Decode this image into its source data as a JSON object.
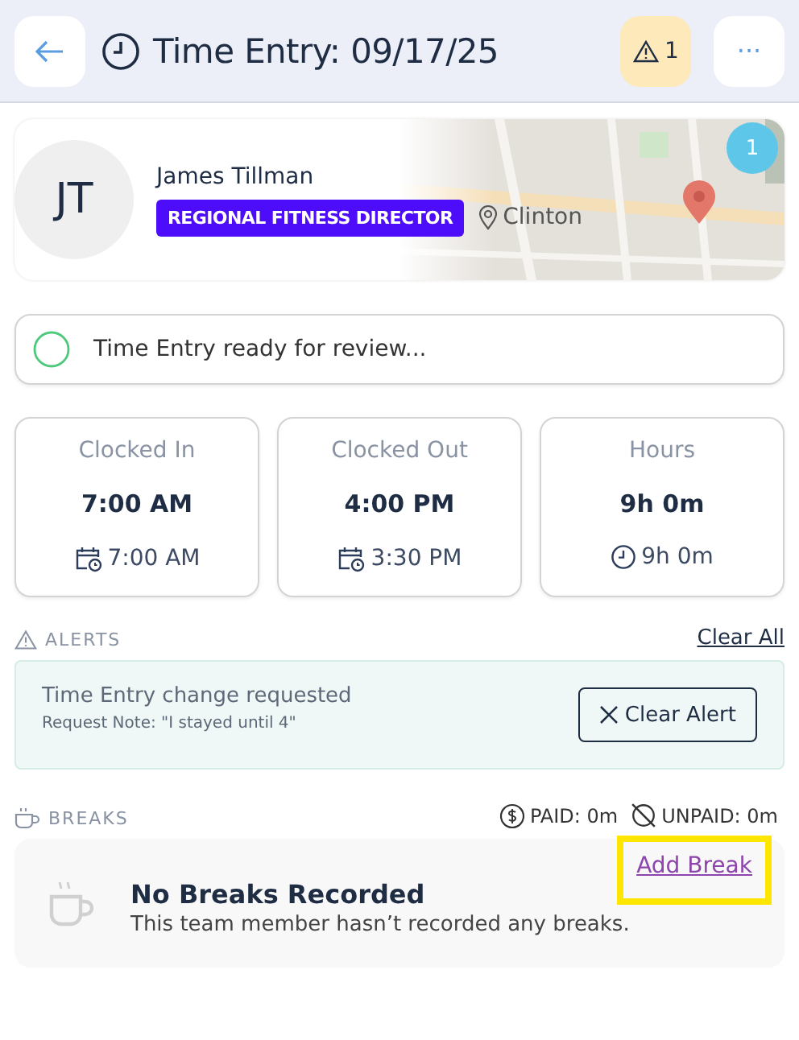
{
  "header": {
    "title": "Time Entry: 09/17/25",
    "alert_count": "1",
    "more": "···"
  },
  "profile": {
    "initials": "JT",
    "name": "James Tillman",
    "role": "REGIONAL FITNESS DIRECTOR",
    "location": "Clinton",
    "map": {
      "kind": "picture",
      "badge": "1"
    }
  },
  "status": {
    "text": "Time Entry ready for review..."
  },
  "stats": [
    {
      "label": "Clocked In",
      "value": "7:00 AM",
      "detail": "7:00 AM",
      "kind": "calendar"
    },
    {
      "label": "Clocked Out",
      "value": "4:00 PM",
      "detail": "3:30 PM",
      "kind": "calendar"
    },
    {
      "label": "Hours",
      "value": "9h 0m",
      "detail": "9h 0m",
      "kind": "clock"
    }
  ],
  "alerts": {
    "heading": "ALERTS",
    "clear_all": "Clear All",
    "items": [
      {
        "title": "Time Entry change requested",
        "note": "Request Note: \"I stayed until 4\"",
        "action": "Clear Alert"
      }
    ]
  },
  "breaks": {
    "heading": "BREAKS",
    "paid": "PAID: 0m",
    "unpaid": "UNPAID: 0m",
    "empty_title": "No Breaks Recorded",
    "empty_text": "This team member hasn’t recorded any breaks.",
    "add": "Add Break",
    "add_highlighted": true
  }
}
